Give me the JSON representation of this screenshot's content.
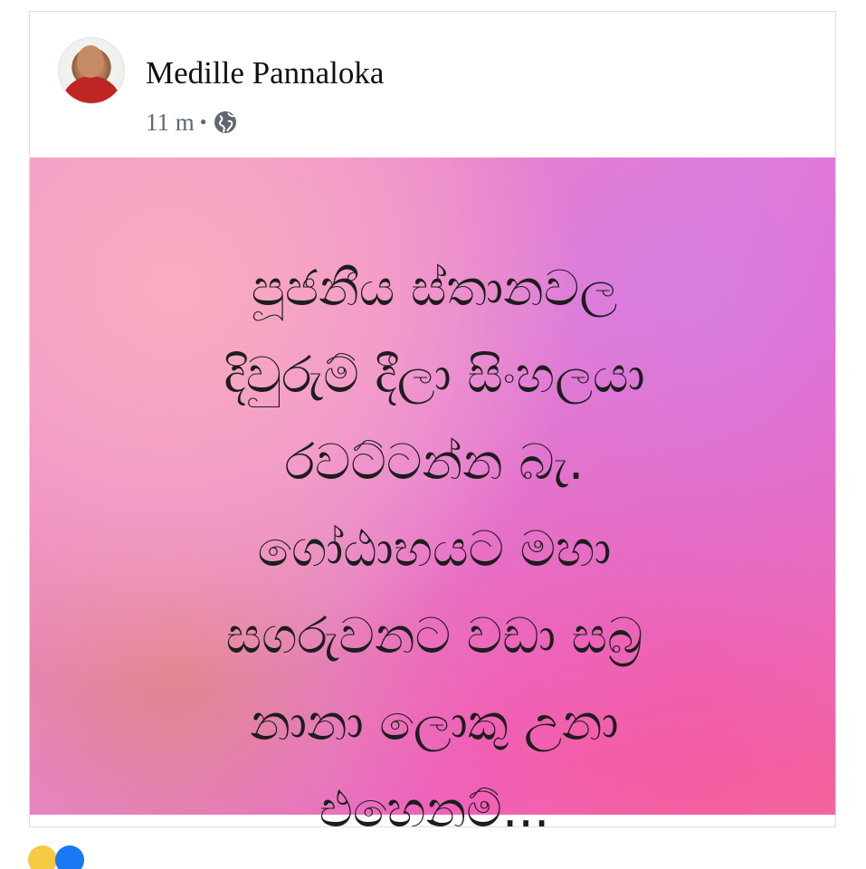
{
  "post": {
    "author_name": "Medille Pannaloka",
    "time": "11 m",
    "separator": "•",
    "privacy_icon": "globe-icon",
    "message": "පූජනීය ස්තානවල\nදිවුරුම් දීලා සිංහලයා\nරවට්ටන්න බැ.\nගෝඨාභයට මහා\nසගරුවනට වඩා සබ්‍ර\nනානා ලොකු උනා\nඑහෙනම්..."
  },
  "colors": {
    "author_text": "#111111",
    "meta_text": "#606770",
    "message_text": "#1d1d1d",
    "card_border": "#dadde1"
  },
  "reactions": [
    {
      "name": "haha-reaction-icon",
      "color": "#f7c940"
    },
    {
      "name": "like-reaction-icon",
      "color": "#1877f2"
    }
  ]
}
